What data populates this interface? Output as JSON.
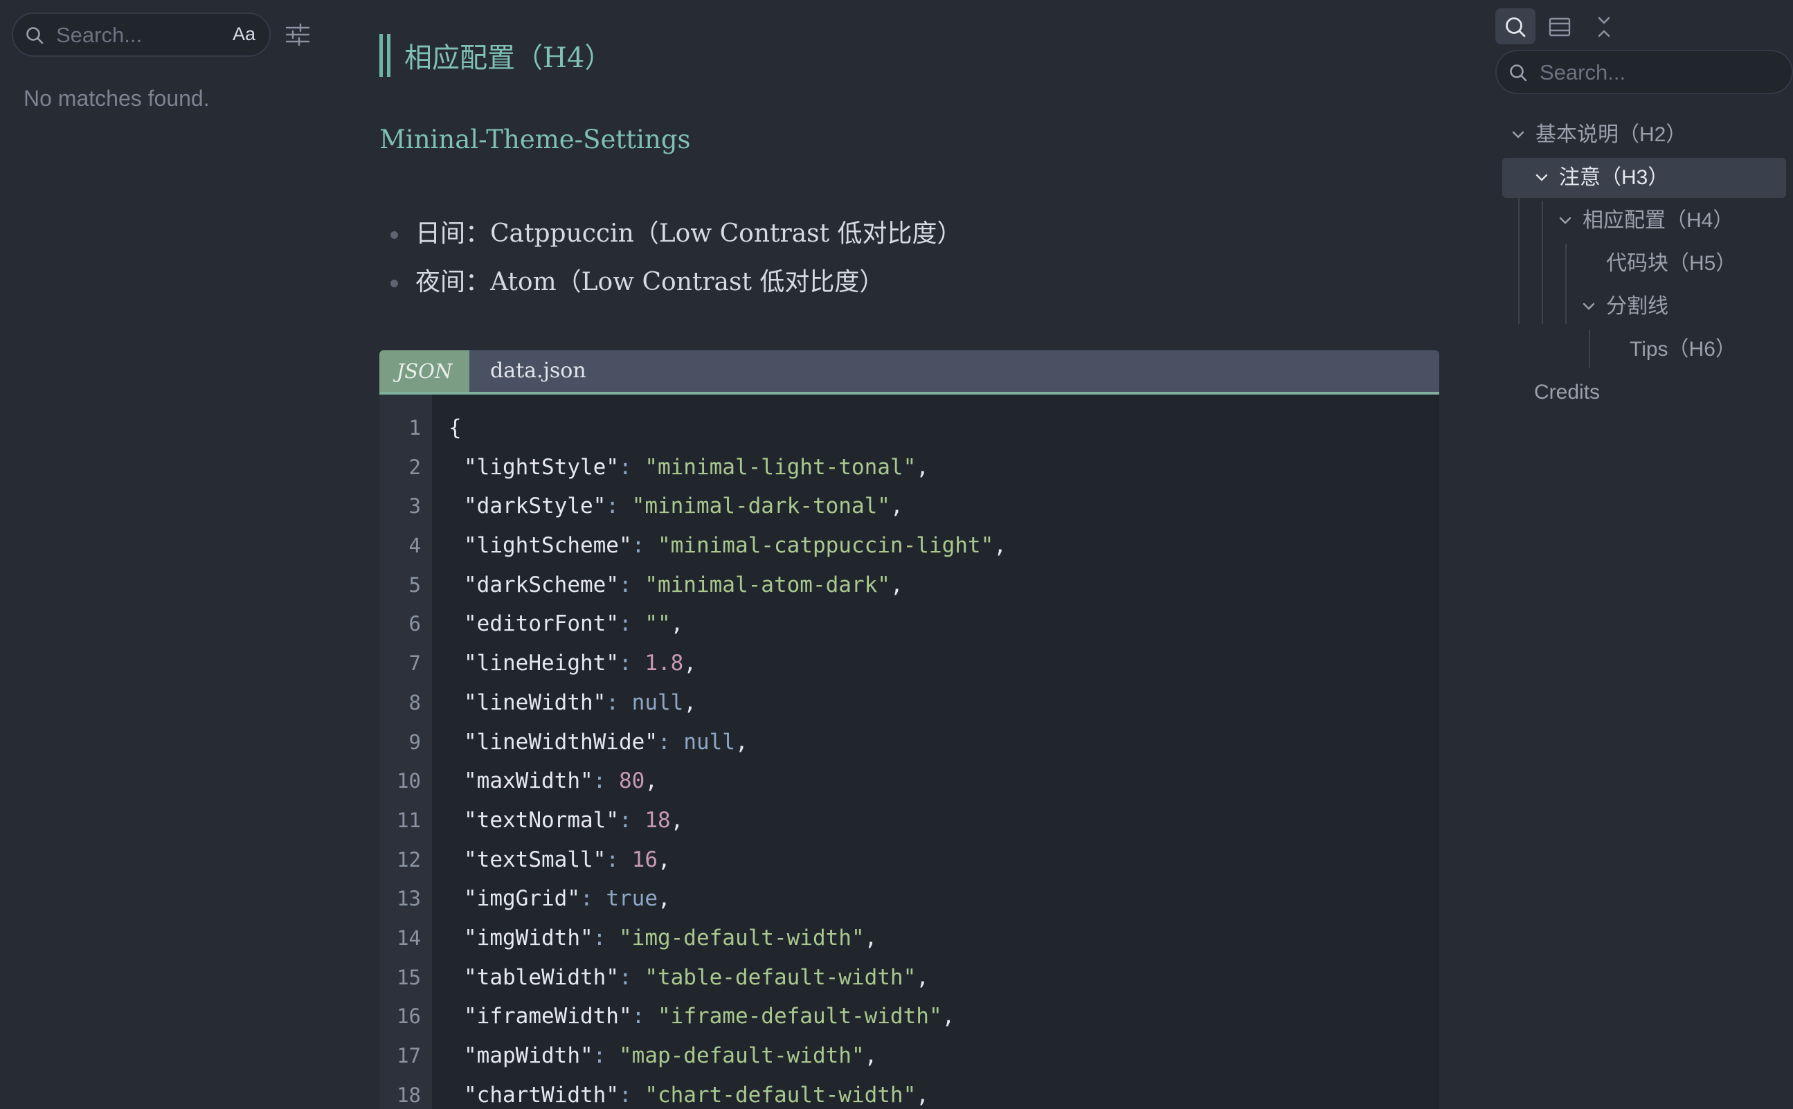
{
  "left_search": {
    "placeholder": "Search...",
    "case_label": "Aa",
    "no_matches": "No matches found."
  },
  "main": {
    "h4_title": "相应配置（H4）",
    "theme_heading": "Mininal-Theme-Settings",
    "bullets": [
      "日间：Catppuccin（Low Contrast 低对比度）",
      "夜间：Atom（Low Contrast 低对比度）"
    ],
    "code": {
      "language": "JSON",
      "filename": "data.json",
      "line_numbers": [
        "1",
        "2",
        "3",
        "4",
        "5",
        "6",
        "7",
        "8",
        "9",
        "10",
        "11",
        "12",
        "13",
        "14",
        "15",
        "16",
        "17",
        "18"
      ],
      "lines": [
        {
          "key": "",
          "value": "",
          "type": "brace"
        },
        {
          "key": "lightStyle",
          "value": "minimal-light-tonal",
          "type": "string"
        },
        {
          "key": "darkStyle",
          "value": "minimal-dark-tonal",
          "type": "string"
        },
        {
          "key": "lightScheme",
          "value": "minimal-catppuccin-light",
          "type": "string"
        },
        {
          "key": "darkScheme",
          "value": "minimal-atom-dark",
          "type": "string"
        },
        {
          "key": "editorFont",
          "value": "",
          "type": "string"
        },
        {
          "key": "lineHeight",
          "value": "1.8",
          "type": "number"
        },
        {
          "key": "lineWidth",
          "value": "null",
          "type": "keyword"
        },
        {
          "key": "lineWidthWide",
          "value": "null",
          "type": "keyword"
        },
        {
          "key": "maxWidth",
          "value": "80",
          "type": "number"
        },
        {
          "key": "textNormal",
          "value": "18",
          "type": "number"
        },
        {
          "key": "textSmall",
          "value": "16",
          "type": "number"
        },
        {
          "key": "imgGrid",
          "value": "true",
          "type": "keyword"
        },
        {
          "key": "imgWidth",
          "value": "img-default-width",
          "type": "string"
        },
        {
          "key": "tableWidth",
          "value": "table-default-width",
          "type": "string"
        },
        {
          "key": "iframeWidth",
          "value": "iframe-default-width",
          "type": "string"
        },
        {
          "key": "mapWidth",
          "value": "map-default-width",
          "type": "string"
        },
        {
          "key": "chartWidth",
          "value": "chart-default-width",
          "type": "string"
        }
      ]
    }
  },
  "right_panel": {
    "search_placeholder": "Search...",
    "outline": [
      {
        "label": "基本说明（H2）",
        "collapsible": true,
        "active": false
      },
      {
        "label": "注意（H3）",
        "collapsible": true,
        "active": true
      },
      {
        "label": "相应配置（H4）",
        "collapsible": true,
        "active": false
      },
      {
        "label": "代码块（H5）",
        "collapsible": false,
        "active": false
      },
      {
        "label": "分割线",
        "collapsible": true,
        "active": false
      },
      {
        "label": "Tips（H6）",
        "collapsible": false,
        "active": false
      },
      {
        "label": "Credits",
        "collapsible": false,
        "active": false
      }
    ]
  },
  "colors": {
    "background": "#272b34",
    "heading": "#7fc1b2",
    "code_bg": "#21252c",
    "string": "#a9c88f",
    "number": "#c79ab0",
    "keyword": "#8ea6c4",
    "lang_tab": "#7a9d84"
  }
}
